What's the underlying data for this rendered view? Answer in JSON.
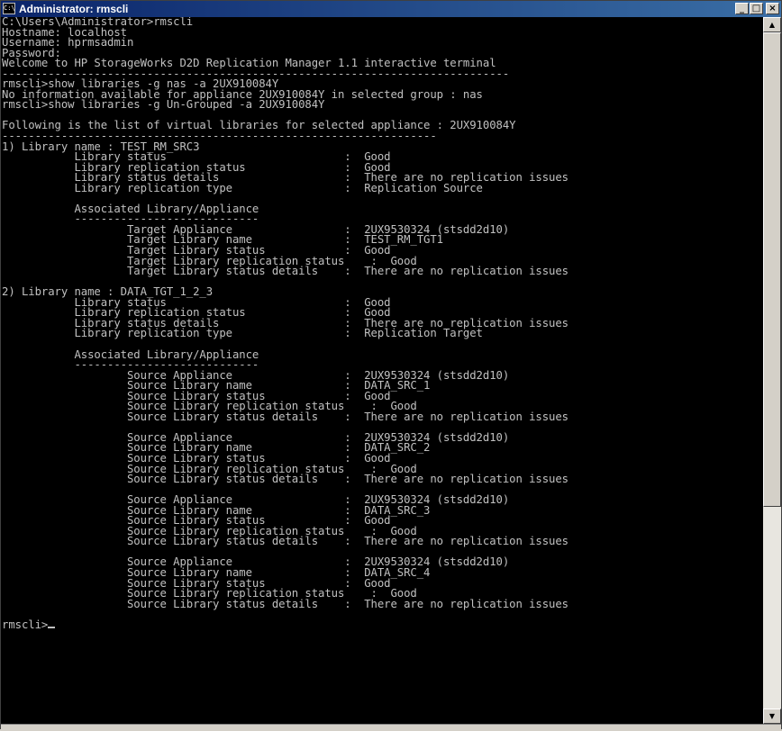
{
  "window": {
    "icon_text": "C:\\",
    "title": "Administrator: rmscli",
    "controls": {
      "minimize": "_",
      "maximize": "□",
      "close": "×"
    }
  },
  "console": {
    "lines": [
      "C:\\Users\\Administrator>rmscli",
      "Hostname: localhost",
      "Username: hprmsadmin",
      "Password:",
      "Welcome to HP StorageWorks D2D Replication Manager 1.1 interactive terminal",
      "-----------------------------------------------------------------------------",
      "rmscli>show libraries -g nas -a 2UX910084Y",
      "No information available for appliance 2UX910084Y in selected group : nas",
      "rmscli>show libraries -g Un-Grouped -a 2UX910084Y",
      "",
      "Following is the list of virtual libraries for selected appliance : 2UX910084Y",
      "------------------------------------------------------------------",
      "1) Library name : TEST_RM_SRC3",
      "           Library status                           :  Good",
      "           Library replication status               :  Good",
      "           Library status details                   :  There are no replication issues",
      "           Library replication type                 :  Replication Source",
      "",
      "           Associated Library/Appliance",
      "           ----------------------------",
      "                   Target Appliance                 :  2UX9530324 (stsdd2d10)",
      "                   Target Library name              :  TEST_RM_TGT1",
      "                   Target Library status            :  Good",
      "                   Target Library replication status    :  Good",
      "                   Target Library status details    :  There are no replication issues",
      "",
      "2) Library name : DATA_TGT_1_2_3",
      "           Library status                           :  Good",
      "           Library replication status               :  Good",
      "           Library status details                   :  There are no replication issues",
      "           Library replication type                 :  Replication Target",
      "",
      "           Associated Library/Appliance",
      "           ----------------------------",
      "                   Source Appliance                 :  2UX9530324 (stsdd2d10)",
      "                   Source Library name              :  DATA_SRC_1",
      "                   Source Library status            :  Good",
      "                   Source Library replication status    :  Good",
      "                   Source Library status details    :  There are no replication issues",
      "",
      "                   Source Appliance                 :  2UX9530324 (stsdd2d10)",
      "                   Source Library name              :  DATA_SRC_2",
      "                   Source Library status            :  Good",
      "                   Source Library replication status    :  Good",
      "                   Source Library status details    :  There are no replication issues",
      "",
      "                   Source Appliance                 :  2UX9530324 (stsdd2d10)",
      "                   Source Library name              :  DATA_SRC_3",
      "                   Source Library status            :  Good",
      "                   Source Library replication status    :  Good",
      "                   Source Library status details    :  There are no replication issues",
      "",
      "                   Source Appliance                 :  2UX9530324 (stsdd2d10)",
      "                   Source Library name              :  DATA_SRC_4",
      "                   Source Library status            :  Good",
      "                   Source Library replication status    :  Good",
      "                   Source Library status details    :  There are no replication issues",
      ""
    ],
    "prompt": "rmscli>"
  },
  "scrollbar": {
    "up_arrow": "▲",
    "down_arrow": "▼"
  },
  "colors": {
    "title_bar_start": "#0a246a",
    "title_bar_end": "#3a6ea5",
    "console_background": "#000000",
    "console_text": "#c0c0c0",
    "chrome": "#d4d0c8"
  }
}
